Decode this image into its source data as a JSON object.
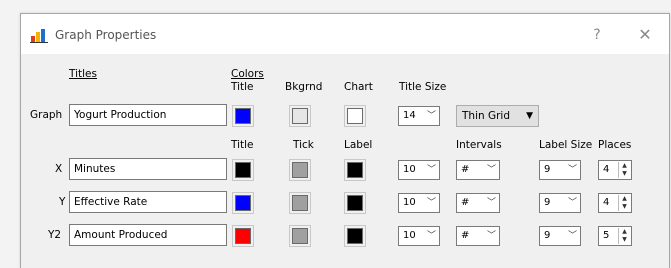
{
  "window": {
    "title": "Graph Properties",
    "help": "?",
    "close": "✕"
  },
  "headers": {
    "titles": "Titles",
    "colors": "Colors",
    "title_col": "Title",
    "bkgrnd": "Bkgrnd",
    "chart": "Chart",
    "title_size": "Title Size",
    "title_col2": "Title",
    "tick": "Tick",
    "label": "Label",
    "intervals": "Intervals",
    "label_size": "Label Size",
    "places": "Places"
  },
  "graph": {
    "label": "Graph",
    "title": "Yogurt Production",
    "title_color": "#0000ff",
    "bkgrnd_color": "#e6e6e6",
    "chart_color": "#ffffff",
    "title_size": "14",
    "grid": "Thin Grid"
  },
  "axes": [
    {
      "label": "X",
      "title": "Minutes",
      "title_color": "#000000",
      "tick_color": "#a0a0a0",
      "label_color": "#000000",
      "size": "10",
      "intervals": "#",
      "label_size": "9",
      "places": "4"
    },
    {
      "label": "Y",
      "title": "Effective Rate",
      "title_color": "#0000ff",
      "tick_color": "#a0a0a0",
      "label_color": "#000000",
      "size": "10",
      "intervals": "#",
      "label_size": "9",
      "places": "4"
    },
    {
      "label": "Y2",
      "title": "Amount Produced",
      "title_color": "#ff0000",
      "tick_color": "#a0a0a0",
      "label_color": "#000000",
      "size": "10",
      "intervals": "#",
      "label_size": "9",
      "places": "5"
    }
  ]
}
